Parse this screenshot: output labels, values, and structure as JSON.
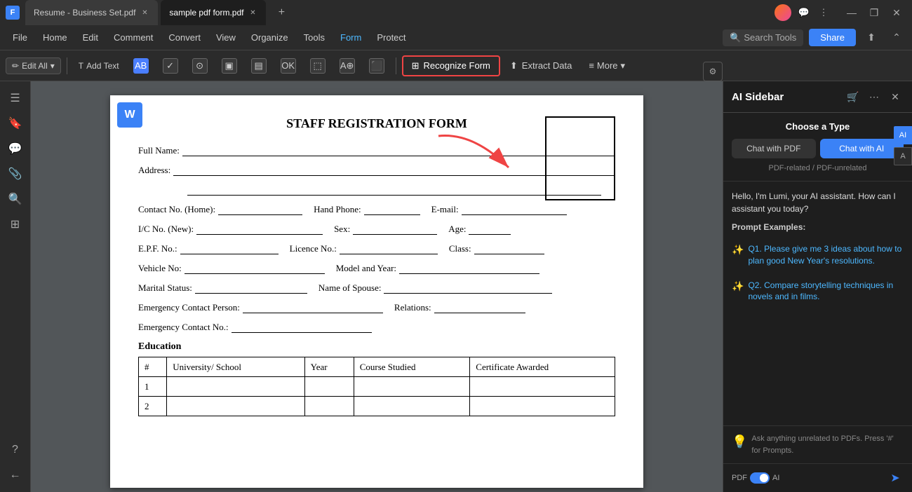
{
  "titleBar": {
    "appIcon": "F",
    "tabs": [
      {
        "label": "Resume - Business Set.pdf",
        "active": false
      },
      {
        "label": "sample pdf form.pdf",
        "active": true
      }
    ],
    "addTab": "+",
    "windowControls": [
      "—",
      "❐",
      "✕"
    ]
  },
  "menuBar": {
    "items": [
      "File",
      "Home",
      "Edit",
      "Comment",
      "Convert",
      "View",
      "Organize",
      "Tools",
      "Form",
      "Protect"
    ],
    "activeItem": "Form",
    "searchPlaceholder": "Search Tools",
    "shareLabel": "Share"
  },
  "toolbar": {
    "editAll": "Edit All",
    "addText": "Add Text",
    "buttons": [
      "AB",
      "✓",
      "●",
      "▣",
      "▤",
      "OK",
      "⬚",
      "A⊕",
      "⬛"
    ],
    "recognizeForm": "Recognize Form",
    "extractData": "Extract Data",
    "more": "More"
  },
  "leftSidebar": {
    "icons": [
      "☰",
      "🔖",
      "💬",
      "📎",
      "🔍",
      "⊞",
      "?",
      "←"
    ]
  },
  "pdfContent": {
    "title": "STAFF REGISTRATION FORM",
    "fields": {
      "fullName": "Full Name:",
      "address": "Address:",
      "contactHome": "Contact No. (Home):",
      "handPhone": "Hand Phone:",
      "email": "E-mail:",
      "icNo": "I/C No. (New):",
      "sex": "Sex:",
      "age": "Age:",
      "epfNo": "E.P.F. No.:",
      "licenceNo": "Licence No.:",
      "class": "Class:",
      "vehicleNo": "Vehicle No:",
      "modelYear": "Model and Year:",
      "maritalStatus": "Marital Status:",
      "nameOfSpouse": "Name of Spouse:",
      "emergencyContact": "Emergency Contact Person:",
      "relations": "Relations:",
      "emergencyContactNo": "Emergency Contact No.:",
      "education": "Education"
    },
    "educationTable": {
      "headers": [
        "#",
        "University/ School",
        "Year",
        "Course Studied",
        "Certificate Awarded"
      ],
      "rows": [
        [
          "1",
          "",
          "",
          "",
          ""
        ],
        [
          "2",
          "",
          "",
          "",
          ""
        ]
      ]
    }
  },
  "aiSidebar": {
    "title": "AI Sidebar",
    "chooseTypeLabel": "Choose a Type",
    "chatWithPDF": "Chat with PDF",
    "chatWithAI": "Chat with AI",
    "subtitle": "PDF-related / PDF-unrelated",
    "greeting": "Hello, I'm Lumi, your AI assistant. How can I assistant you today?",
    "promptExamples": "Prompt Examples:",
    "prompts": [
      "Q1. Please give me 3 ideas about how to plan good New Year's resolutions.",
      "Q2. Compare storytelling techniques in novels and in films."
    ],
    "footerHint": "Ask anything unrelated to PDFs. Press '#' for Prompts.",
    "pdfLabel": "PDF",
    "aiLabel": "AI"
  }
}
